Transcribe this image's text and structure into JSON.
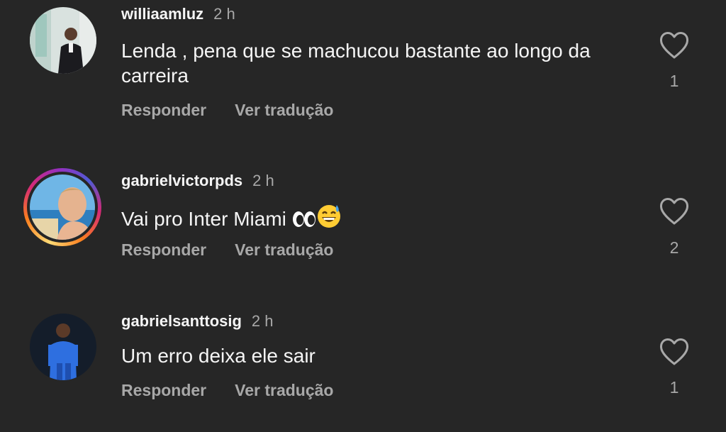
{
  "comments": [
    {
      "username": "williaamluz",
      "time": "2 h",
      "text": "Lenda , pena que se machucou bastante ao longo da carreira",
      "reply_label": "Responder",
      "translate_label": "Ver tradução",
      "likes": "1",
      "has_story_ring": false
    },
    {
      "username": "gabrielvictorpds",
      "time": "2 h",
      "text": "Vai pro Inter Miami",
      "emojis": [
        "eyes-emoji",
        "grinning-sweat-emoji"
      ],
      "reply_label": "Responder",
      "translate_label": "Ver tradução",
      "likes": "2",
      "has_story_ring": true
    },
    {
      "username": "gabrielsanttosig",
      "time": "2 h",
      "text": "Um erro deixa ele sair",
      "reply_label": "Responder",
      "translate_label": "Ver tradução",
      "likes": "1",
      "has_story_ring": false
    }
  ],
  "colors": {
    "background": "#262626",
    "primary_text": "#f5f5f5",
    "secondary_text": "#a8a8a8"
  },
  "icons": {
    "like": "heart-outline-icon"
  }
}
